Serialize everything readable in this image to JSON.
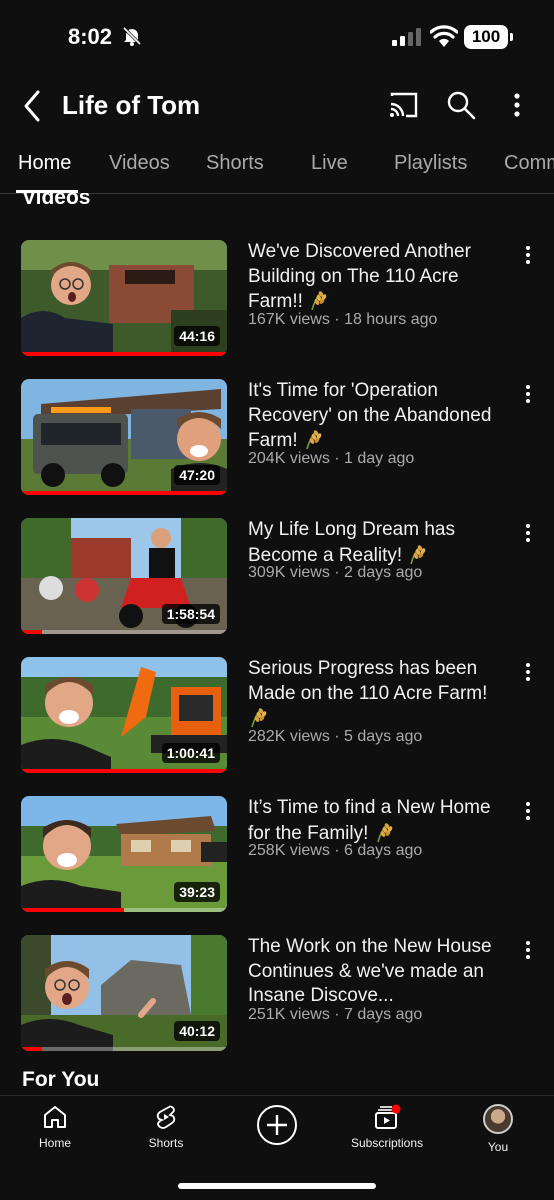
{
  "status_bar": {
    "time": "8:02",
    "battery": "100"
  },
  "header": {
    "channel_name": "Life of Tom"
  },
  "tabs": [
    {
      "label": "Home",
      "active": true
    },
    {
      "label": "Videos"
    },
    {
      "label": "Shorts"
    },
    {
      "label": "Live"
    },
    {
      "label": "Playlists"
    },
    {
      "label": "Comm"
    }
  ],
  "sections": {
    "videos": "Videos",
    "for_you": "For You"
  },
  "videos": [
    {
      "title": "We've Discovered Another Building on The 110 Acre Farm!!",
      "meta": "167K views · 18 hours ago",
      "duration": "44:16",
      "watched_fraction": 1.0
    },
    {
      "title": "It's Time for 'Operation Recovery' on the Abandoned Farm!",
      "meta": "204K views · 1 day ago",
      "duration": "47:20",
      "watched_fraction": 1.0
    },
    {
      "title": "My Life Long Dream has Become a Reality!",
      "meta": "309K views · 2 days ago",
      "duration": "1:58:54",
      "watched_fraction": 0.1
    },
    {
      "title": "Serious Progress has been Made on the 110 Acre Farm!",
      "meta": "282K views · 5 days ago",
      "duration": "1:00:41",
      "watched_fraction": 1.0
    },
    {
      "title": "It’s Time to find a New Home for the Family!",
      "meta": "258K views · 6 days ago",
      "duration": "39:23",
      "watched_fraction": 0.5
    },
    {
      "title": "The Work on the New House Continues & we've made an Insane Discove...",
      "meta": "251K views · 7 days ago",
      "duration": "40:12",
      "watched_fraction": 0.1
    }
  ],
  "bottom_nav": [
    {
      "label": "Home",
      "icon": "home-icon"
    },
    {
      "label": "Shorts",
      "icon": "shorts-icon"
    },
    {
      "label": "",
      "icon": "create-icon"
    },
    {
      "label": "Subscriptions",
      "icon": "subscriptions-icon"
    },
    {
      "label": "You",
      "icon": "avatar"
    }
  ],
  "colors": {
    "background": "#0f0f0f",
    "accent": "#ff0000",
    "secondary_text": "#aaaaaa"
  }
}
